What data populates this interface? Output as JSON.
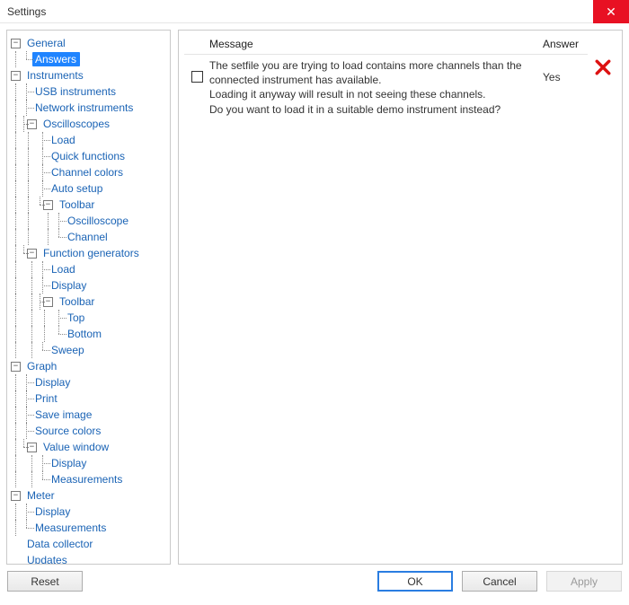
{
  "window": {
    "title": "Settings"
  },
  "tree": {
    "general": "General",
    "answers": "Answers",
    "instruments": "Instruments",
    "usb_instruments": "USB instruments",
    "network_instruments": "Network instruments",
    "oscilloscopes": "Oscilloscopes",
    "load": "Load",
    "quick_functions": "Quick functions",
    "channel_colors": "Channel colors",
    "auto_setup": "Auto setup",
    "toolbar": "Toolbar",
    "oscilloscope": "Oscilloscope",
    "channel": "Channel",
    "function_generators": "Function generators",
    "fg_load": "Load",
    "fg_display": "Display",
    "fg_toolbar": "Toolbar",
    "fg_top": "Top",
    "fg_bottom": "Bottom",
    "fg_sweep": "Sweep",
    "graph": "Graph",
    "g_display": "Display",
    "g_print": "Print",
    "g_save_image": "Save image",
    "g_source_colors": "Source colors",
    "g_value_window": "Value window",
    "g_vw_display": "Display",
    "g_vw_measurements": "Measurements",
    "meter": "Meter",
    "m_display": "Display",
    "m_measurements": "Measurements",
    "data_collector": "Data collector",
    "updates": "Updates"
  },
  "table": {
    "header_message": "Message",
    "header_answer": "Answer",
    "rows": [
      {
        "checked": false,
        "line1": "The setfile you are trying to load contains more channels than the",
        "line2": "connected instrument has available.",
        "line3": "Loading it anyway will result in not seeing these channels.",
        "line4": "Do you want to load it in a suitable demo instrument instead?",
        "answer": "Yes"
      }
    ]
  },
  "buttons": {
    "reset": "Reset",
    "ok": "OK",
    "cancel": "Cancel",
    "apply": "Apply"
  }
}
